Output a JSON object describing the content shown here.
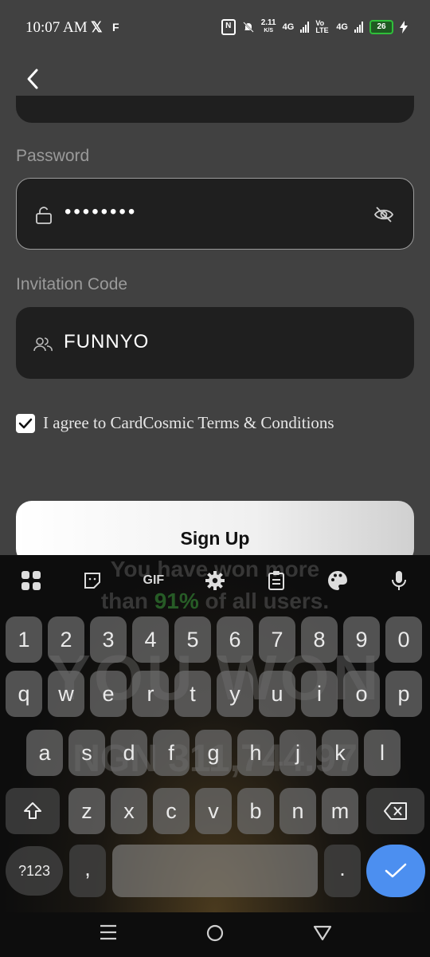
{
  "status_bar": {
    "time": "10:07 AM",
    "net_speed_value": "2.11",
    "net_speed_unit": "K/S",
    "net_1": "4G",
    "volte": "Vo LTE",
    "net_2": "4G",
    "battery": "26"
  },
  "form": {
    "password_label": "Password",
    "password_value": "••••••••",
    "invitation_label": "Invitation Code",
    "invitation_value": "FUNNYO",
    "agree_text": "I agree to CardCosmic Terms & Conditions",
    "agree_checked": true,
    "signup_label": "Sign Up"
  },
  "keyboard": {
    "toolbar": [
      "apps-icon",
      "sticker-icon",
      "GIF",
      "settings-icon",
      "clipboard-icon",
      "palette-icon",
      "mic-icon"
    ],
    "gif_label": "GIF",
    "number_row": [
      "1",
      "2",
      "3",
      "4",
      "5",
      "6",
      "7",
      "8",
      "9",
      "0"
    ],
    "row1": [
      "q",
      "w",
      "e",
      "r",
      "t",
      "y",
      "u",
      "i",
      "o",
      "p"
    ],
    "row2": [
      "a",
      "s",
      "d",
      "f",
      "g",
      "h",
      "j",
      "k",
      "l"
    ],
    "row3": [
      "z",
      "x",
      "c",
      "v",
      "b",
      "n",
      "m"
    ],
    "symbols_key": "?123",
    "comma_key": ",",
    "period_key": ".",
    "background_ad": {
      "line1": "You have won more",
      "line2_pre": "than ",
      "line2_pct": "91%",
      "line2_post": " of all users.",
      "headline": "YOU WON",
      "amount": "NGN 311,744.97"
    }
  },
  "colors": {
    "accent_blue": "#4c8ff0",
    "battery_green": "#2fbf3a",
    "ad_green": "#3b9a3b"
  }
}
